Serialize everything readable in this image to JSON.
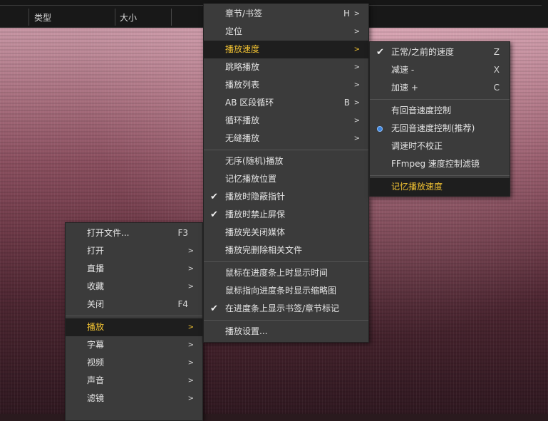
{
  "header": {
    "col_type": "类型",
    "col_size": "大小"
  },
  "main_menu": [
    {
      "label": "打开文件...",
      "shortcut": "F3"
    },
    {
      "label": "打开",
      "submenu": true
    },
    {
      "label": "直播",
      "submenu": true
    },
    {
      "label": "收藏",
      "submenu": true
    },
    {
      "label": "关闭",
      "shortcut": "F4"
    },
    {
      "sep": true
    },
    {
      "label": "播放",
      "submenu": true,
      "highlighted": true
    },
    {
      "label": "字幕",
      "submenu": true
    },
    {
      "label": "视频",
      "submenu": true
    },
    {
      "label": "声音",
      "submenu": true
    },
    {
      "label": "滤镜",
      "submenu": true
    }
  ],
  "play_menu": [
    {
      "label": "章节/书签",
      "shortcut": "H"
    },
    {
      "label": "定位",
      "submenu": true
    },
    {
      "label": "播放速度",
      "submenu": true,
      "highlighted": true
    },
    {
      "label": "跳略播放",
      "submenu": true
    },
    {
      "label": "播放列表",
      "submenu": true
    },
    {
      "label": "AB 区段循环",
      "shortcut": "B"
    },
    {
      "label": "循环播放",
      "submenu": true
    },
    {
      "label": "无缝播放",
      "submenu": true
    },
    {
      "sep": true
    },
    {
      "label": "无序(随机)播放"
    },
    {
      "label": "记忆播放位置"
    },
    {
      "label": "播放时隐蔽指针",
      "checked": true
    },
    {
      "label": "播放时禁止屏保",
      "checked": true
    },
    {
      "label": "播放完关闭媒体"
    },
    {
      "label": "播放完删除相关文件"
    },
    {
      "sep": true
    },
    {
      "label": "鼠标在进度条上时显示时间"
    },
    {
      "label": "鼠标指向进度条时显示缩略图"
    },
    {
      "label": "在进度条上显示书签/章节标记",
      "checked": true
    },
    {
      "sep": true
    },
    {
      "label": "播放设置..."
    }
  ],
  "speed_menu": [
    {
      "label": "正常/之前的速度",
      "shortcut": "Z",
      "checked": true
    },
    {
      "label": "减速 -",
      "shortcut": "X"
    },
    {
      "label": "加速 +",
      "shortcut": "C"
    },
    {
      "sep": true
    },
    {
      "label": "有回音速度控制"
    },
    {
      "label": "无回音速度控制(推荐)",
      "radio": true
    },
    {
      "label": "调速时不校正"
    },
    {
      "label": "FFmpeg 速度控制滤镜"
    },
    {
      "sep": true
    },
    {
      "label": "记忆播放速度",
      "highlighted": true
    }
  ],
  "colors": {
    "highlight_text": "#f1c232",
    "menu_bg": "#3b3b3b",
    "radio": "#3d86e0"
  }
}
